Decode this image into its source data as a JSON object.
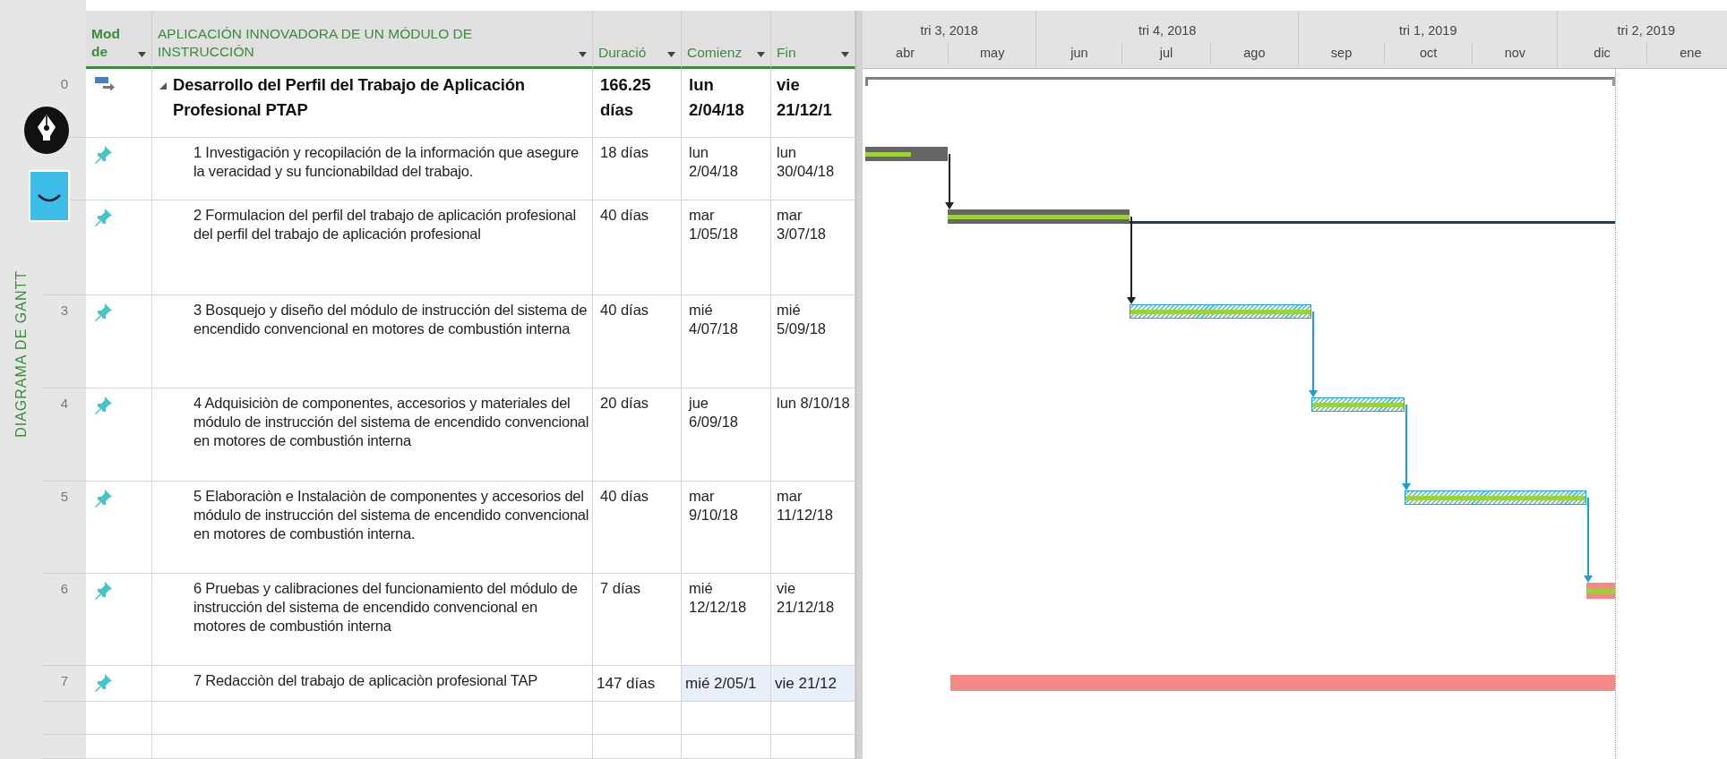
{
  "side_label": "DIAGRAMA DE GANTT",
  "columns": [
    {
      "label": "Mod de",
      "kind": "mode"
    },
    {
      "label": "APLICACIÓN INNOVADORA DE UN MÓDULO DE INSTRUCCIÓN",
      "kind": "name"
    },
    {
      "label": "Duració",
      "kind": "duration"
    },
    {
      "label": "Comienz",
      "kind": "start"
    },
    {
      "label": "Fin",
      "kind": "finish"
    }
  ],
  "timescale": {
    "quarters": [
      {
        "label": "tri 3, 2018",
        "months": [
          "abr",
          "may"
        ]
      },
      {
        "label": "tri 4, 2018",
        "months": [
          "jun",
          "jul",
          "ago"
        ]
      },
      {
        "label": "tri 1, 2019",
        "months": [
          "sep",
          "oct",
          "nov"
        ]
      },
      {
        "label": "tri 2, 2019",
        "months": [
          "dic",
          "ene"
        ]
      }
    ]
  },
  "tasks": [
    {
      "id": "0",
      "kind": "summary",
      "name": "Desarrollo del Perfil del Trabajo de Aplicación Profesional PTAP",
      "duration": "166.25 días",
      "start": "lun 2/04/18",
      "finish": "vie 21/12/1",
      "linked": false,
      "slack": false,
      "highlight": false
    },
    {
      "kind": "gray",
      "name": "1 Investigación y recopilación de la información que asegure la veracidad y su funcionabildad del trabajo.",
      "duration": "18 días",
      "start": "lun 2/04/18",
      "finish": "lun 30/04/18",
      "level": 0.55,
      "linked": false,
      "slack": false,
      "highlight": false
    },
    {
      "kind": "gray",
      "name": "2 Formulacion del perfil del trabajo de aplicación profesional del perfil del trabajo de aplicación profesional",
      "duration": "40 días",
      "start": "mar 1/05/18",
      "finish": "mar 3/07/18",
      "level": 1,
      "linked": true,
      "slack": true,
      "highlight": false
    },
    {
      "id": "3",
      "kind": "hatched",
      "name": "3 Bosquejo y diseño del módulo de instrucción del sistema de encendido convencional en motores de combustión interna",
      "duration": "40 días",
      "start": "mié 4/07/18",
      "finish": "mié 5/09/18",
      "level": 1,
      "linked": true,
      "slack": false,
      "highlight": false
    },
    {
      "id": "4",
      "kind": "hatched",
      "name": "4 Adquisiciòn de componentes, accesorios y materiales del módulo de instrucción del sistema de encendido convencional en motores de combustión interna",
      "duration": "20 días",
      "start": "jue 6/09/18",
      "finish": "lun 8/10/18",
      "level": 1,
      "linked": true,
      "slack": false,
      "highlight": false
    },
    {
      "id": "5",
      "kind": "hatched",
      "name": "5 Elaboraciòn e Instalaciòn de componentes y accesorios del módulo de instrucción del sistema de encendido convencional en motores de combustión interna.",
      "duration": "40 días",
      "start": "mar 9/10/18",
      "finish": "mar 11/12/18",
      "level": 1,
      "linked": true,
      "slack": false,
      "highlight": false
    },
    {
      "id": "6",
      "kind": "critical",
      "name": "6 Pruebas y calibraciones del funcionamiento del módulo de instrucción del sistema de encendido convencional en motores de combustión interna",
      "duration": "7 días",
      "start": "mié 12/12/18",
      "finish": "vie 21/12/18",
      "level": 1,
      "linked": true,
      "slack": false,
      "highlight": false
    },
    {
      "id": "7",
      "kind": "critical",
      "name": "7 Redacciòn del trabajo de aplicaciòn profesional TAP",
      "duration": "147 días",
      "start": "mié 2/05/1",
      "finish": "vie 21/12",
      "level": 0,
      "linked": false,
      "slack": false,
      "highlight": true
    }
  ]
}
